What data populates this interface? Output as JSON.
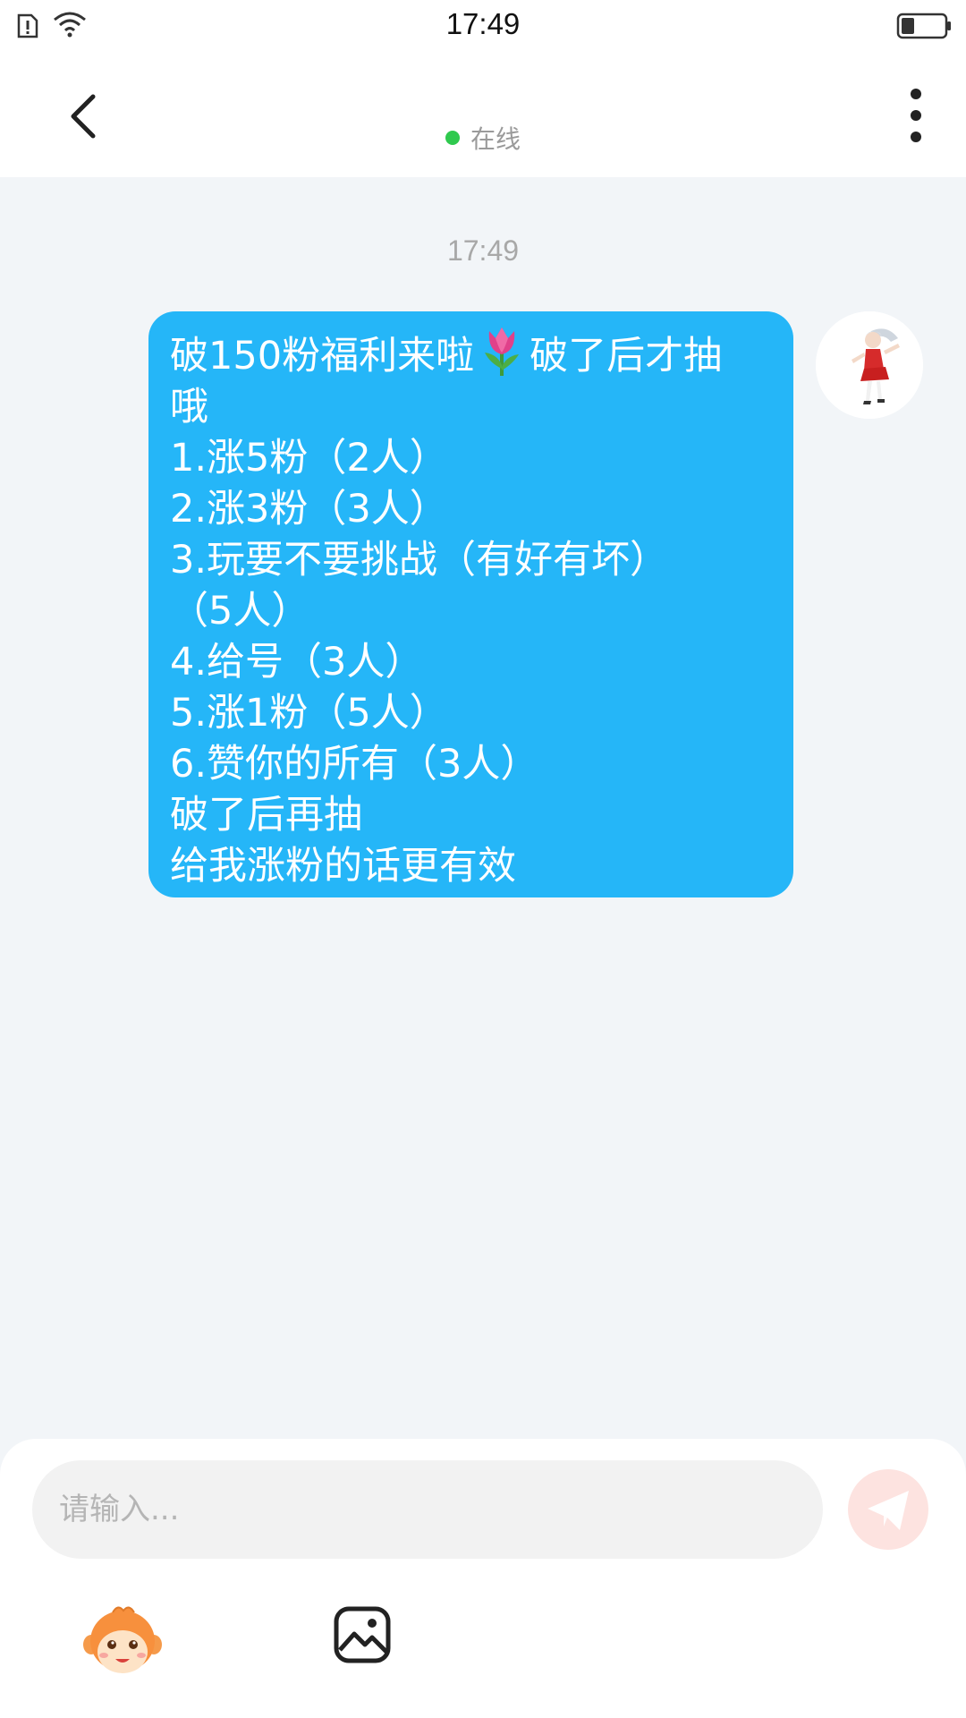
{
  "status_bar": {
    "time": "17:49",
    "icons": [
      "sim-alert-icon",
      "wifi-icon",
      "battery-icon"
    ]
  },
  "nav": {
    "back_icon": "chevron-left-icon",
    "more_icon": "more-vertical-icon",
    "online_status": "在线",
    "online_color": "#2fc94e"
  },
  "conversation": {
    "timestamp": "17:49",
    "messages": [
      {
        "sender": "self",
        "bubble_color": "#25b6f8",
        "lines": [
          "破150粉福利来啦",
          "破了后才抽",
          "哦",
          "1.涨5粉（2人）",
          "2.涨3粉（3人）",
          "3.玩要不要挑战（有好有坏）",
          "（5人）",
          "4.给号（3人）",
          "5.涨1粉（5人）",
          "6.赞你的所有（3人）",
          "破了后再抽",
          "给我涨粉的话更有效"
        ],
        "emoji": "tulip-icon"
      }
    ]
  },
  "composer": {
    "placeholder": "请输入...",
    "send_icon": "paper-plane-icon",
    "emoji_icon": "monkey-face-icon",
    "image_icon": "image-icon"
  }
}
